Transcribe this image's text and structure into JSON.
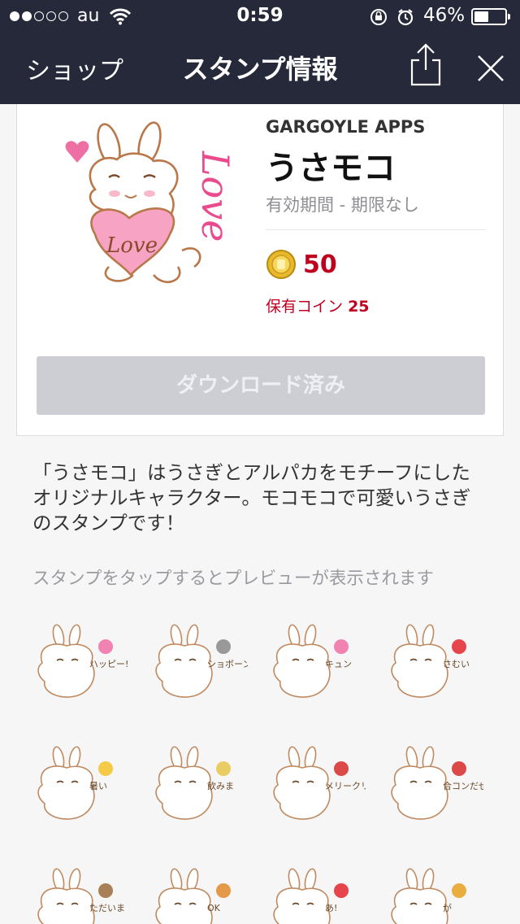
{
  "status_bar": {
    "carrier": "au",
    "time": "0:59",
    "battery_percent": "46%",
    "battery_level": 0.46,
    "signal_strength": 2
  },
  "nav": {
    "back_label": "ショップ",
    "title": "スタンプ情報",
    "share_icon": "share-icon",
    "close_icon": "close-icon"
  },
  "sticker": {
    "publisher": "GARGOYLE APPS",
    "name": "うさモコ",
    "validity": "有効期間 - 期限なし",
    "price": "50",
    "owned_label": "保有コイン",
    "owned_coins": "25",
    "download_label": "ダウンロード済み",
    "main_image_text": "Love",
    "main_image_love": "Love"
  },
  "description": "「うさモコ」はうさぎとアルパカをモチーフにしたオリジナルキャラクター。モコモコで可愛いうさぎのスタンプです！",
  "preview_hint": "スタンプをタップするとプレビューが表示されます",
  "previews": [
    {
      "name": "sticker-happy",
      "caption": "ハッピー!"
    },
    {
      "name": "sticker-sad",
      "caption": "ショボーン"
    },
    {
      "name": "sticker-love",
      "caption": "キュン"
    },
    {
      "name": "sticker-cold",
      "caption": "さむい"
    },
    {
      "name": "sticker-hot",
      "caption": "暑い"
    },
    {
      "name": "sticker-drink",
      "caption": "飲みま"
    },
    {
      "name": "sticker-christmas",
      "caption": "メリークリスマス!"
    },
    {
      "name": "sticker-party",
      "caption": "合コンだぜ"
    },
    {
      "name": "sticker-home",
      "caption": "ただいま"
    },
    {
      "name": "sticker-ok",
      "caption": "OK"
    },
    {
      "name": "sticker-surprise",
      "caption": "あ!"
    },
    {
      "name": "sticker-shock",
      "caption": "が"
    }
  ],
  "colors": {
    "nav_bg": "#26293a",
    "price_red": "#c0001f",
    "button_disabled": "#ccced4",
    "sticker_line": "#b9774a",
    "sticker_pink": "#ee6fa4"
  }
}
